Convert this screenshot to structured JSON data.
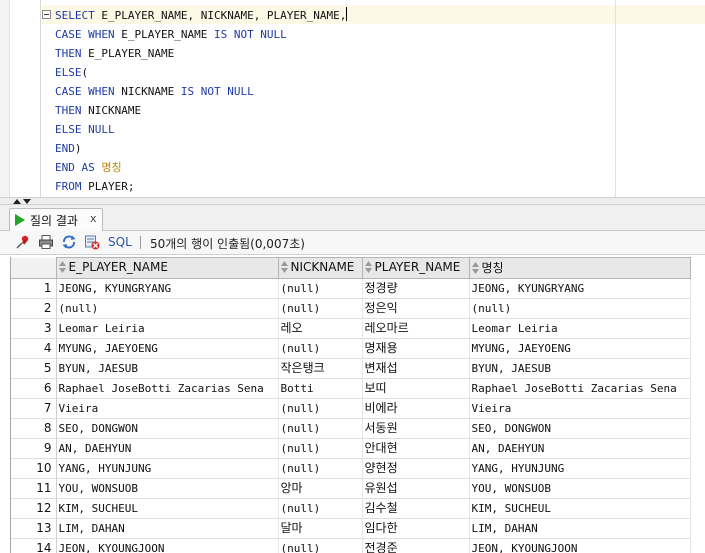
{
  "editor": {
    "lines": [
      [
        {
          "t": "SELECT",
          "k": "kw"
        },
        {
          "t": " E_PLAYER_NAME, NICKNAME, PLAYER_NAME,",
          "k": ""
        }
      ],
      [
        {
          "t": "CASE WHEN",
          "k": "kw"
        },
        {
          "t": " E_PLAYER_NAME ",
          "k": ""
        },
        {
          "t": "IS NOT NULL",
          "k": "kw"
        }
      ],
      [
        {
          "t": "THEN",
          "k": "kw"
        },
        {
          "t": " E_PLAYER_NAME",
          "k": ""
        }
      ],
      [
        {
          "t": "ELSE",
          "k": "kw"
        },
        {
          "t": "(",
          "k": ""
        }
      ],
      [
        {
          "t": "CASE WHEN",
          "k": "kw"
        },
        {
          "t": " NICKNAME ",
          "k": ""
        },
        {
          "t": "IS NOT NULL",
          "k": "kw"
        }
      ],
      [
        {
          "t": "THEN",
          "k": "kw"
        },
        {
          "t": " NICKNAME",
          "k": ""
        }
      ],
      [
        {
          "t": "ELSE NULL",
          "k": "kw"
        }
      ],
      [
        {
          "t": "END",
          "k": "kw"
        },
        {
          "t": ")",
          "k": ""
        }
      ],
      [
        {
          "t": "END AS",
          "k": "kw"
        },
        {
          "t": " ",
          "k": ""
        },
        {
          "t": "명칭",
          "k": "al"
        }
      ],
      [
        {
          "t": "FROM",
          "k": "kw"
        },
        {
          "t": " PLAYER;",
          "k": ""
        }
      ]
    ]
  },
  "result_tab": {
    "label": "질의 결과",
    "close": "x"
  },
  "toolbar": {
    "icons": [
      "pin-icon",
      "print-icon",
      "refresh-icon",
      "delete-icon"
    ],
    "sql_label": "SQL",
    "status": "50개의 행이 인출됨(0,007초)"
  },
  "grid": {
    "columns": [
      "E_PLAYER_NAME",
      "NICKNAME",
      "PLAYER_NAME",
      "명칭"
    ],
    "rows": [
      [
        "1",
        "JEONG, KYUNGRYANG",
        "(null)",
        "정경량",
        "JEONG, KYUNGRYANG"
      ],
      [
        "2",
        "(null)",
        "(null)",
        "정은익",
        "(null)"
      ],
      [
        "3",
        "Leomar Leiria",
        "레오",
        "레오마르",
        "Leomar Leiria"
      ],
      [
        "4",
        "MYUNG, JAEYOENG",
        "(null)",
        "명재용",
        "MYUNG, JAEYOENG"
      ],
      [
        "5",
        "BYUN, JAESUB",
        "작은탱크",
        "변재섭",
        "BYUN, JAESUB"
      ],
      [
        "6",
        "Raphael JoseBotti Zacarias Sena",
        "Botti",
        "보띠",
        "Raphael JoseBotti Zacarias Sena"
      ],
      [
        "7",
        "Vieira",
        "(null)",
        "비에라",
        "Vieira"
      ],
      [
        "8",
        "SEO, DONGWON",
        "(null)",
        "서동원",
        "SEO, DONGWON"
      ],
      [
        "9",
        "AN, DAEHYUN",
        "(null)",
        "안대현",
        "AN, DAEHYUN"
      ],
      [
        "10",
        "YANG, HYUNJUNG",
        "(null)",
        "양현정",
        "YANG, HYUNJUNG"
      ],
      [
        "11",
        "YOU, WONSUOB",
        "앙마",
        "유원섭",
        "YOU, WONSUOB"
      ],
      [
        "12",
        "KIM, SUCHEUL",
        "(null)",
        "김수철",
        "KIM, SUCHEUL"
      ],
      [
        "13",
        "LIM, DAHAN",
        "달마",
        "임다한",
        "LIM, DAHAN"
      ],
      [
        "14",
        "JEON, KYOUNGJOON",
        "(null)",
        "전경준",
        "JEON, KYOUNGJOON"
      ]
    ]
  }
}
